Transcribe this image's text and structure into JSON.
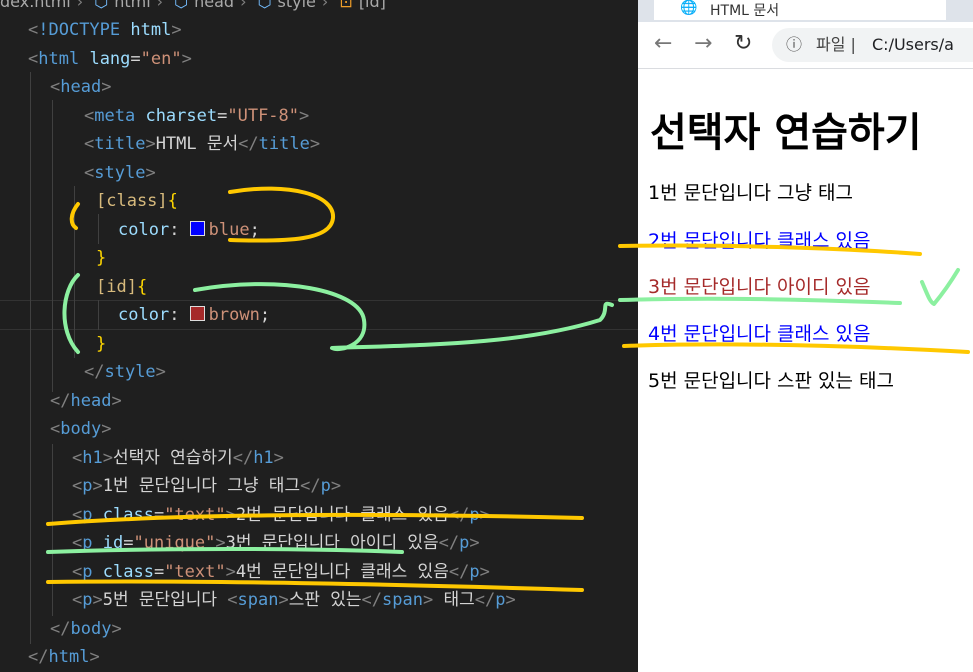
{
  "breadcrumb": [
    "dex.html",
    "html",
    "head",
    "style",
    "[id]"
  ],
  "code": {
    "doctype": "!DOCTYPE",
    "html_tag": "html",
    "lang_attr": "lang",
    "lang_val": "\"en\"",
    "head_tag": "head",
    "meta_tag": "meta",
    "charset_attr": "charset",
    "charset_val": "\"UTF-8\"",
    "title_tag": "title",
    "title_text": "HTML 문서",
    "style_tag": "style",
    "sel_class": "[class]",
    "sel_id": "[id]",
    "prop_color": "color",
    "val_blue": "blue",
    "val_brown": "brown",
    "body_tag": "body",
    "h1_tag": "h1",
    "h1_text": "선택자 연습하기",
    "p_tag": "p",
    "class_attr": "class",
    "class_val": "\"text\"",
    "id_attr": "id",
    "id_val": "\"unique\"",
    "span_tag": "span",
    "p1": "1번 문단입니다 그냥 태그",
    "p2": "2번 문단입니다 클래스 있음",
    "p3": "3번 문단입니다 아이디 있음",
    "p4": "4번 문단입니다 클래스 있음",
    "p5a": "5번 문단입니다 ",
    "span_text": "스판 있는",
    "p5b": " 태그"
  },
  "browser": {
    "tab_title": "HTML 문서",
    "scheme_label": "파일",
    "url": "C:/Users/a",
    "h1": "선택자 연습하기",
    "paragraphs": [
      {
        "text": "1번 문단입니다 그냥 태그",
        "color": "#000000"
      },
      {
        "text": "2번 문단입니다 클래스 있음",
        "color": "#0000ff"
      },
      {
        "text": "3번 문단입니다 아이디 있음",
        "color": "#a52a2a"
      },
      {
        "text": "4번 문단입니다 클래스 있음",
        "color": "#0000ff"
      },
      {
        "text": "5번 문단입니다 스판 있는 태그",
        "color": "#000000"
      }
    ]
  },
  "colors": {
    "swatch_blue": "#0000ff",
    "swatch_brown": "#a52a2a",
    "yellow_marker": "#ffc800",
    "green_marker": "#8cf0a0"
  }
}
